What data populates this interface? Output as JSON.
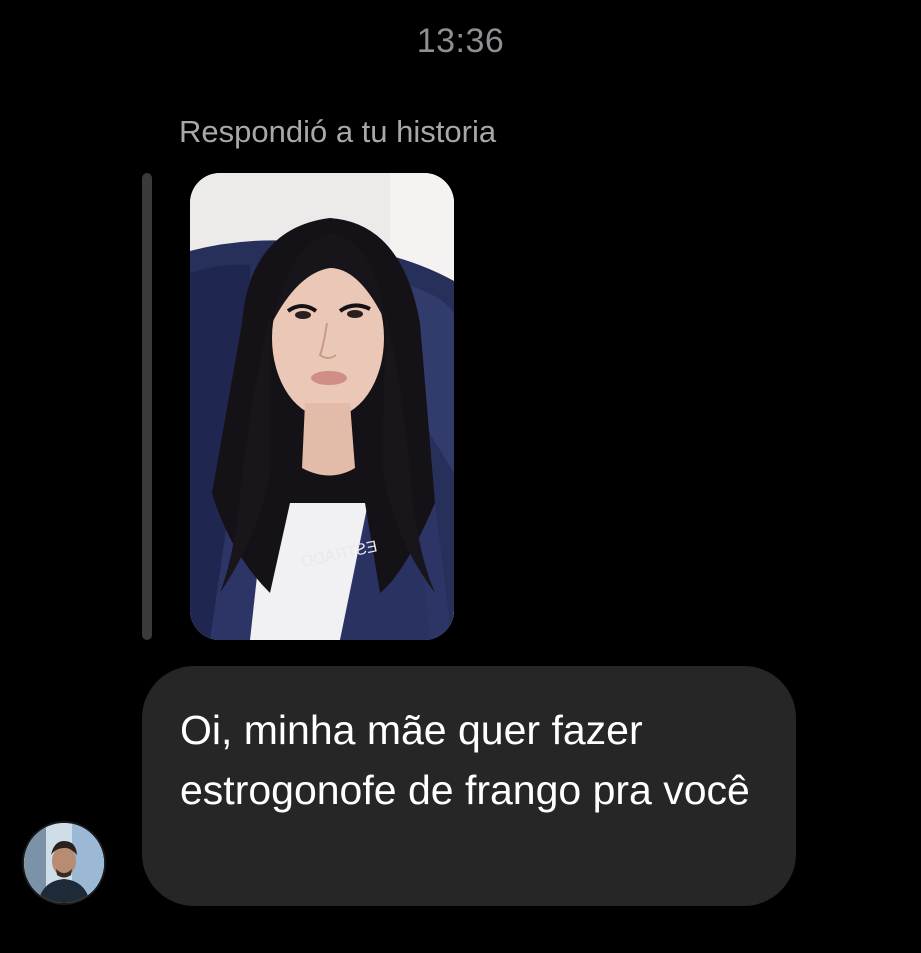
{
  "conversation": {
    "timestamp": "13:36",
    "reply_context": "Respondió a tu historia"
  },
  "story_preview": {
    "icon": "story-photo-thumbnail",
    "jersey_text": "ESTRADO"
  },
  "message": {
    "text": "Oi, minha mãe quer fazer estrogonofe de frango pra você",
    "bubble_color": "#262626",
    "text_color": "#ffffff"
  },
  "sender": {
    "icon": "user-avatar"
  },
  "colors": {
    "background": "#000000",
    "meta_text": "#8e8e93",
    "reply_bar": "#3a3a3c"
  }
}
